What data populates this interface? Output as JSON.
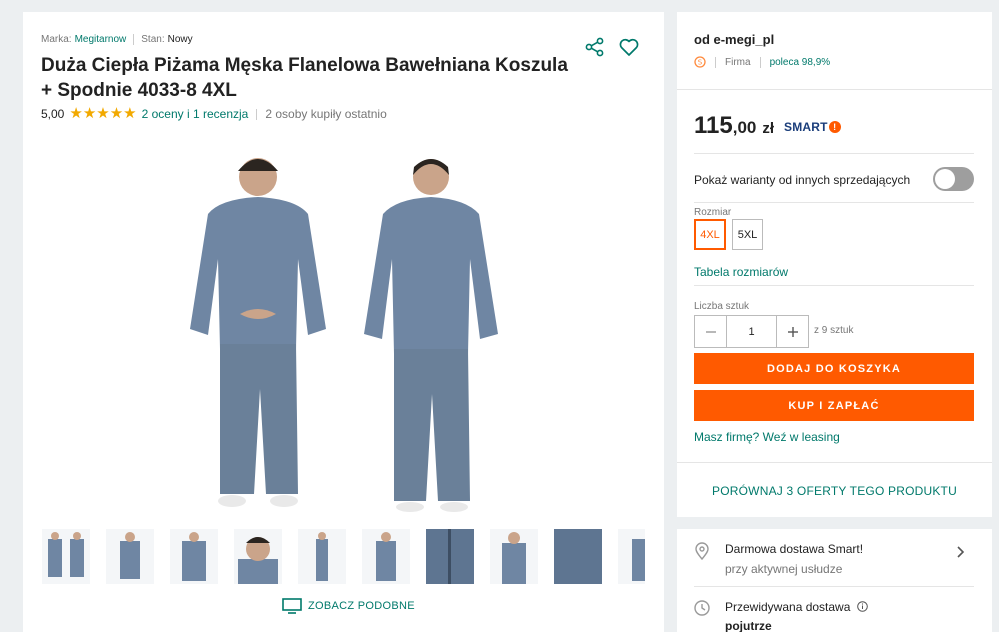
{
  "product": {
    "brand_label": "Marka:",
    "brand": "Megitarnow",
    "condition_label": "Stan:",
    "condition": "Nowy",
    "title": "Duża Ciepła Piżama Męska Flanelowa Bawełniana Koszula + Spodnie 4033-8 4XL",
    "rating": "5,00",
    "stars": 5,
    "reviews": "2 oceny i 1 recenzja",
    "bought": "2 osoby kupiły ostatnio",
    "thumbnail_count": 10,
    "see_similar": "ZOBACZ PODOBNE"
  },
  "seller": {
    "name": "od e-megi_pl",
    "type": "Firma",
    "recommend": "poleca 98,9%"
  },
  "offer": {
    "price_int": "115",
    "price_dec": ",00",
    "currency": "zł",
    "smart_label": "SMART",
    "smart_bang": "!",
    "variants_label": "Pokaż warianty od innych sprzedających",
    "variants_toggle_on": false,
    "size_label": "Rozmiar",
    "sizes": [
      "4XL",
      "5XL"
    ],
    "selected_size": "4XL",
    "size_table": "Tabela rozmiarów",
    "qty_label": "Liczba sztuk",
    "qty_value": "1",
    "qty_minus": "—",
    "qty_plus": "+",
    "qty_note": "z 9 sztuk",
    "add_to_cart": "DODAJ DO KOSZYKA",
    "buy_now": "KUP I ZAPŁAĆ",
    "leasing": "Masz firmę? Weź w leasing",
    "compare": "PORÓWNAJ 3 OFERTY TEGO PRODUKTU"
  },
  "delivery": {
    "free_title": "Darmowa dostawa Smart!",
    "free_sub": "przy aktywnej usłudze",
    "expected_title": "Przewidywana dostawa",
    "expected_value": "pojutrze"
  },
  "colors": {
    "accent": "#ff5a00",
    "link": "#00796b",
    "smart_blue": "#1a3d7a",
    "star": "#f2a900"
  }
}
